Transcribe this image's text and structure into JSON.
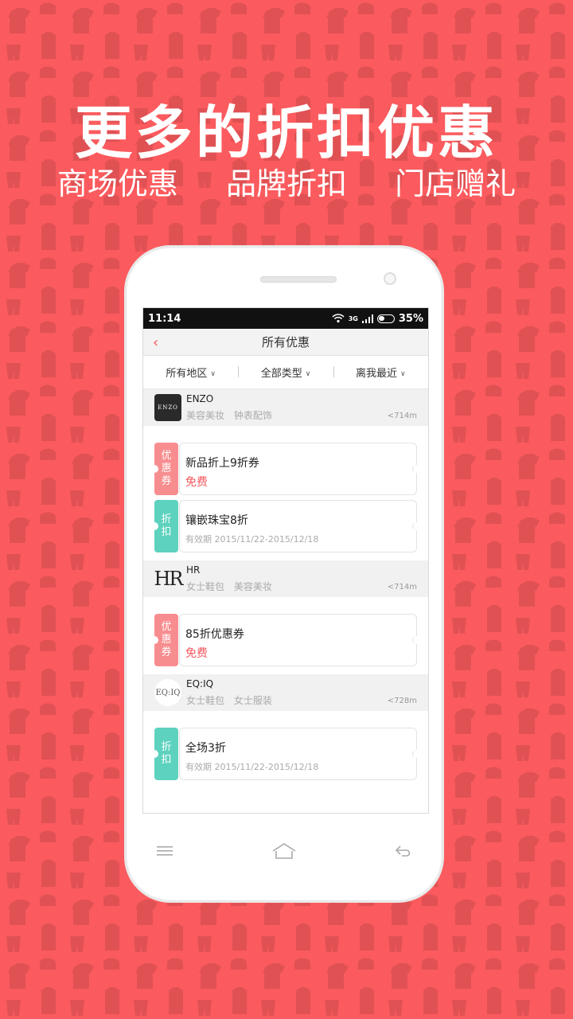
{
  "headline": "更多的折扣优惠",
  "subline": [
    "商场优惠",
    "品牌折扣",
    "门店赠礼"
  ],
  "status": {
    "time": "11:14",
    "signal_label": "3G",
    "battery": "35%"
  },
  "navbar": {
    "title": "所有优惠"
  },
  "filters": [
    "所有地区",
    "全部类型",
    "离我最近"
  ],
  "shops": [
    {
      "name": "ENZO",
      "logo_text": "ENZO",
      "tags": [
        "美容美妆",
        "钟表配饰"
      ],
      "distance": "<714m",
      "coupons": [
        {
          "tag": "优惠券",
          "type": "coupon",
          "title": "新品折上9折券",
          "price": "免费",
          "valid": ""
        },
        {
          "tag": "折扣",
          "type": "discount",
          "title": "镶嵌珠宝8折",
          "price": "",
          "valid": "有效期 2015/11/22-2015/12/18"
        }
      ]
    },
    {
      "name": "HR",
      "logo_text": "HR",
      "tags": [
        "女士鞋包",
        "美容美妆"
      ],
      "distance": "<714m",
      "coupons": [
        {
          "tag": "优惠券",
          "type": "coupon",
          "title": "85折优惠券",
          "price": "免费",
          "valid": ""
        }
      ]
    },
    {
      "name": "EQ:IQ",
      "logo_text": "EQ:IQ",
      "tags": [
        "女士鞋包",
        "女士服装"
      ],
      "distance": "<728m",
      "coupons": [
        {
          "tag": "折扣",
          "type": "discount",
          "title": "全场3折",
          "price": "",
          "valid": "有效期 2015/11/22-2015/12/18"
        }
      ]
    }
  ],
  "colors": {
    "background": "#fb5b5e",
    "accent": "#f5565d",
    "coupon_tag": "#f88d8f",
    "discount_tag": "#5dd2be"
  }
}
